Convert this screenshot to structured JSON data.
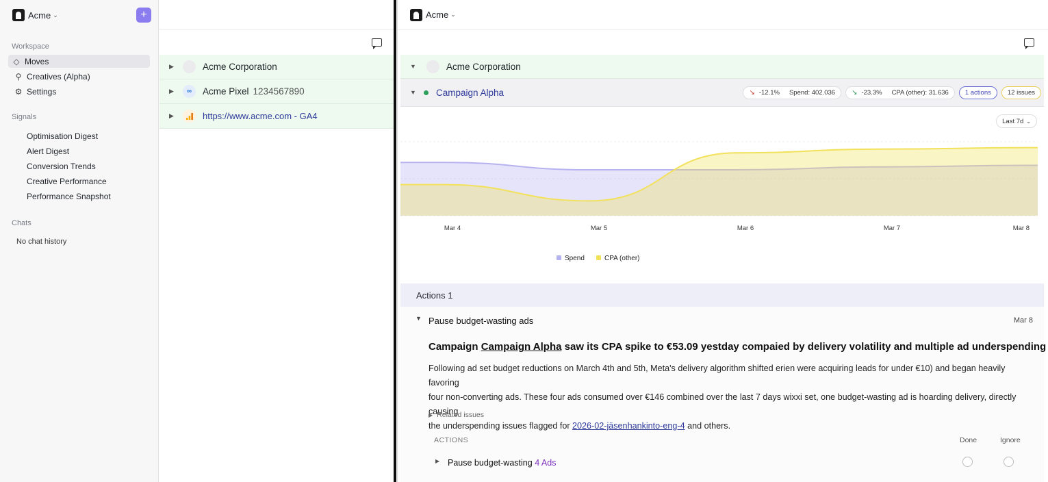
{
  "sidebar": {
    "workspace_name": "Acme",
    "workspace_section": "Workspace",
    "nav": [
      {
        "label": "Moves",
        "icon": "moves-icon"
      },
      {
        "label": "Creatives (Alpha)",
        "icon": "search-icon"
      },
      {
        "label": "Settings",
        "icon": "gear-icon"
      }
    ],
    "signals_section": "Signals",
    "signals": [
      "Optimisation Digest",
      "Alert Digest",
      "Conversion Trends",
      "Creative Performance",
      "Performance Snapshot"
    ],
    "chats_section": "Chats",
    "chats_empty": "No chat history"
  },
  "middle": {
    "rows": [
      {
        "name": "Acme Corporation",
        "sub": "",
        "icon": "avatar-placeholder-icon"
      },
      {
        "name": "Acme Pixel",
        "sub": "1234567890",
        "icon": "meta-infinity-icon"
      },
      {
        "name": "https://www.acme.com - GA4",
        "sub": "",
        "icon": "google-analytics-icon"
      }
    ]
  },
  "right": {
    "workspace_name": "Acme",
    "org_name": "Acme Corporation",
    "campaign": {
      "name": "Campaign Alpha",
      "status_color": "#2e9e5b",
      "metric1_change": "-12.1%",
      "metric1_label": "Spend: 402.036",
      "metric2_change": "-23.3%",
      "metric2_label": "CPA (other): 31.636",
      "actions_badge": "1 actions",
      "issues_badge": "12 issues"
    },
    "range_label": "Last 7d",
    "actions_header": "Actions 1",
    "action": {
      "title": "Pause budget-wasting ads",
      "date": "Mar 8",
      "headline_pre": "Campaign ",
      "headline_link": "Campaign Alpha",
      "headline_post": " saw its CPA spike to €53.09 yestday compaied by delivery volatility and multiple ad underspending alerts.",
      "body_line1": "Following ad set budget reductions on March 4th and 5th, Meta's delivery algorithm shifted erien were acquiring leads for under €10) and began heavily favoring",
      "body_line2": "four non-converting ads. These four ads consumed over €146 combined over the last 7 days wixxi set, one budget-wasting ad is hoarding delivery, directly causing",
      "body_line3_pre": "the underspending issues flagged for ",
      "body_line3_link": "2026-02-jäsenhankinto-eng-4",
      "body_line3_post": " and others.",
      "related_label": "Related issues",
      "table_header": "ACTIONS",
      "col_done": "Done",
      "col_ignore": "Ignore",
      "sub_action_label": "Pause budget-wasting",
      "sub_action_count": "4 Ads"
    }
  },
  "chart_data": {
    "type": "area",
    "x": [
      "Mar 4",
      "Mar 5",
      "Mar 6",
      "Mar 7",
      "Mar 8"
    ],
    "series": [
      {
        "name": "Spend",
        "color": "#b7b2f0",
        "values": [
          0.72,
          0.62,
          0.62,
          0.66,
          0.68
        ]
      },
      {
        "name": "CPA (other)",
        "color": "#f2e15a",
        "values": [
          0.42,
          0.2,
          0.85,
          0.9,
          0.92
        ]
      }
    ],
    "grid": true,
    "legend": "bottom-center"
  }
}
